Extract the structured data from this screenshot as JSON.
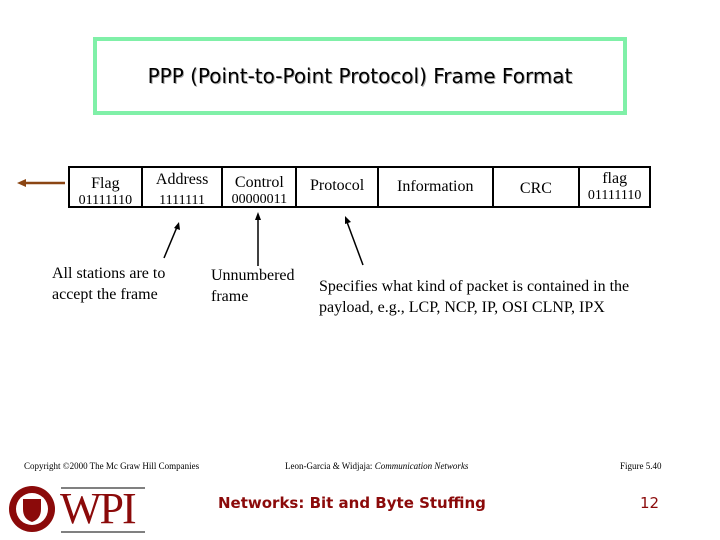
{
  "title": "PPP (Point-to-Point Protocol) Frame Format",
  "fields": [
    {
      "label": "Flag",
      "bits": "01111110"
    },
    {
      "label": "Address",
      "bits": "1111111"
    },
    {
      "label": "Control",
      "bits": "00000011"
    },
    {
      "label": "Protocol",
      "bits": ""
    },
    {
      "label": "Information",
      "bits": ""
    },
    {
      "label": "CRC",
      "bits": ""
    },
    {
      "label": "flag",
      "bits": "01111110"
    }
  ],
  "notes": {
    "address": [
      "All stations are to",
      "accept the frame"
    ],
    "control": [
      "Unnumbered",
      "frame"
    ],
    "protocol": [
      "Specifies what kind of packet is contained in the",
      "payload, e.g.,  LCP, NCP, IP, OSI CLNP, IPX"
    ]
  },
  "footer": {
    "copyright": "Copyright ©2000 The Mc Graw Hill Companies",
    "authors": "Leon-Garcia & Widjaja:",
    "book": "Communication Networks",
    "figure": "Figure 5.40"
  },
  "logo": "WPI",
  "slide_title": "Networks: Bit and Byte Stuffing",
  "page_number": "12",
  "colors": {
    "title_border": "#80f0a8",
    "brand": "#8b0a0a",
    "arrow": "#8b4513"
  }
}
